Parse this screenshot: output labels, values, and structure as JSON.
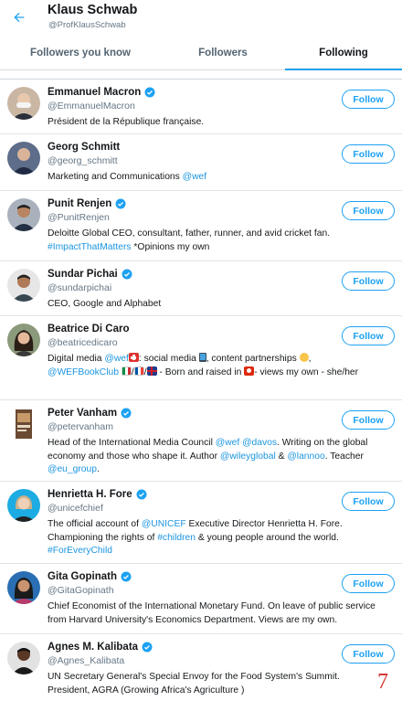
{
  "header": {
    "title": "Klaus Schwab",
    "handle": "@ProfKlausSchwab"
  },
  "tabs": [
    {
      "label": "Followers you know"
    },
    {
      "label": "Followers"
    },
    {
      "label": "Following"
    }
  ],
  "follow_label": "Follow",
  "page_number": "7",
  "accounts": [
    {
      "name": "Emmanuel Macron",
      "verified": true,
      "handle": "@EmmanuelMacron",
      "bio_text": "Président de la République française."
    },
    {
      "name": "Georg Schmitt",
      "verified": false,
      "handle": "@georg_schmitt",
      "bio_pre": "Marketing and Communications ",
      "bio_link": "@wef"
    },
    {
      "name": "Punit Renjen",
      "verified": true,
      "handle": "@PunitRenjen",
      "bio_pre": "Deloitte Global CEO, consultant, father, runner, and avid cricket fan.",
      "bio_link": "#ImpactThatMatters",
      "bio_post": " *Opinions my own"
    },
    {
      "name": "Sundar Pichai",
      "verified": true,
      "handle": "@sundarpichai",
      "bio_text": "CEO, Google and Alphabet"
    },
    {
      "name": "Beatrice Di Caro",
      "verified": false,
      "handle": "@beatricedicaro",
      "bio_a": "Digital media ",
      "bio_link1": "@wef",
      "bio_b": ": social media ",
      "bio_c": ", content partnerships ",
      "bio_d": ",",
      "bio_link2": "@WEFBookClub",
      "bio_e": " ",
      "bio_f": "/",
      "bio_g": "/",
      "bio_h": " - Born and raised in ",
      "bio_i": "- views my own - she/her"
    },
    {
      "name": "Peter Vanham",
      "verified": true,
      "handle": "@petervanham",
      "bio_a": "Head of the International Media Council ",
      "bio_link1": "@wef",
      "bio_b": " ",
      "bio_link2": "@davos",
      "bio_c": ". Writing on the global economy and those who shape it. Author ",
      "bio_link3": "@wileyglobal",
      "bio_d": " & ",
      "bio_link4": "@lannoo",
      "bio_e": ". Teacher ",
      "bio_link5": "@eu_group",
      "bio_f": "."
    },
    {
      "name": "Henrietta H. Fore",
      "verified": true,
      "handle": "@unicefchief",
      "bio_a": "The official account of ",
      "bio_link1": "@UNICEF",
      "bio_b": " Executive Director Henrietta H. Fore. Championing the rights of ",
      "bio_link2": "#children",
      "bio_c": " & young people around the world.",
      "bio_link3": "#ForEveryChild"
    },
    {
      "name": "Gita Gopinath",
      "verified": true,
      "handle": "@GitaGopinath",
      "bio_text": "Chief Economist of the International Monetary Fund. On leave of public service from Harvard University's Economics Department. Views are my own."
    },
    {
      "name": "Agnes M. Kalibata",
      "verified": true,
      "handle": "@Agnes_Kalibata",
      "bio_text": "UN Secretary General's Special Envoy for the Food System's Summit. President, AGRA (Growing Africa's Agriculture )"
    }
  ]
}
